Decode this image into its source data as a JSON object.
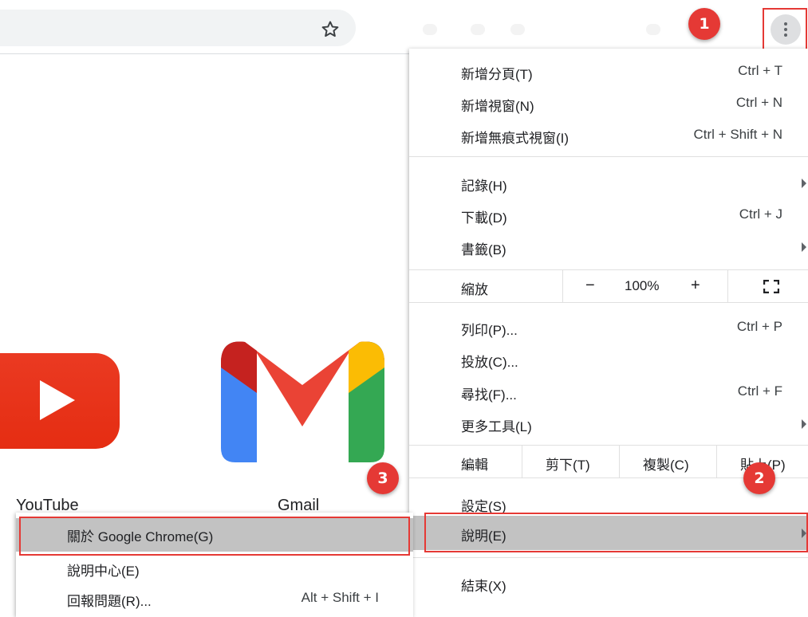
{
  "toolbar": {
    "star_icon": "star-outline-icon",
    "menu_icon": "three-dots-vertical-icon"
  },
  "badges": [
    "1",
    "2",
    "3"
  ],
  "shortcuts": [
    {
      "label": "YouTube",
      "icon": "youtube-icon"
    },
    {
      "label": "Gmail",
      "icon": "gmail-icon"
    }
  ],
  "menu": {
    "new_tab": {
      "label": "新增分頁(T)",
      "shortcut": "Ctrl + T"
    },
    "new_window": {
      "label": "新增視窗(N)",
      "shortcut": "Ctrl + N"
    },
    "new_incognito": {
      "label": "新增無痕式視窗(I)",
      "shortcut": "Ctrl + Shift + N"
    },
    "history": {
      "label": "記錄(H)"
    },
    "downloads": {
      "label": "下載(D)",
      "shortcut": "Ctrl + J"
    },
    "bookmarks": {
      "label": "書籤(B)"
    },
    "zoom": {
      "label": "縮放",
      "minus": "−",
      "level": "100%",
      "plus": "+",
      "fullscreen_icon": "fullscreen-icon"
    },
    "print": {
      "label": "列印(P)...",
      "shortcut": "Ctrl + P"
    },
    "cast": {
      "label": "投放(C)..."
    },
    "find": {
      "label": "尋找(F)...",
      "shortcut": "Ctrl + F"
    },
    "more_tools": {
      "label": "更多工具(L)"
    },
    "edit": {
      "label": "編輯",
      "cut": "剪下(T)",
      "copy": "複製(C)",
      "paste": "貼上(P)"
    },
    "settings": {
      "label": "設定(S)"
    },
    "help": {
      "label": "說明(E)"
    },
    "exit": {
      "label": "結束(X)"
    }
  },
  "submenu": {
    "about": {
      "label": "關於 Google Chrome(G)"
    },
    "help_center": {
      "label": "說明中心(E)"
    },
    "report_issue": {
      "label": "回報問題(R)...",
      "shortcut": "Alt + Shift + I"
    }
  },
  "colors": {
    "annotation_red": "#e53935",
    "highlight_gray": "#c2c2c2",
    "youtube_red": "#e8321c"
  }
}
